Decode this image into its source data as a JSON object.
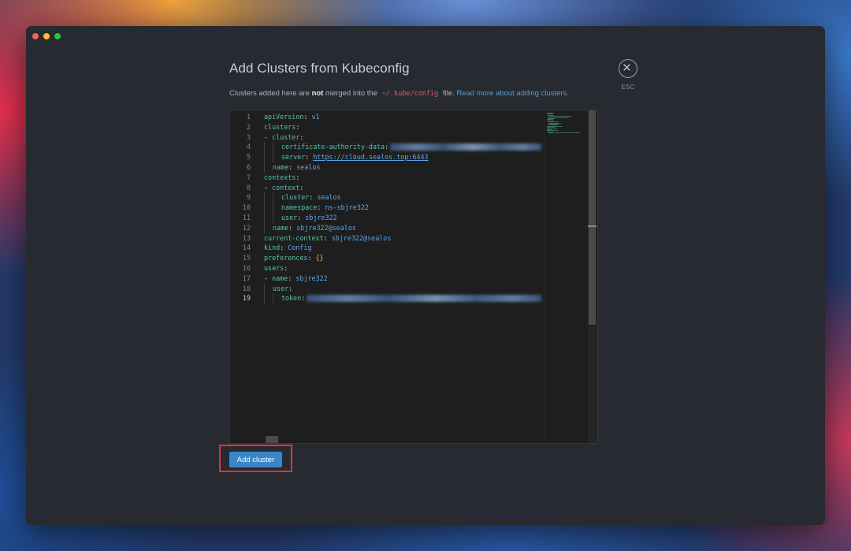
{
  "dialog": {
    "title": "Add Clusters from Kubeconfig",
    "esc_label": "ESC",
    "subtitle": {
      "prefix": "Clusters added here are",
      "emphasis": "not",
      "middle": "merged into the",
      "path": "~/.kube/config",
      "suffix": "file.",
      "link": "Read more about adding clusters."
    },
    "submit_label": "Add cluster"
  },
  "editor": {
    "active_line": 19,
    "lines": [
      {
        "n": "1",
        "key": "apiVersion",
        "value": "v1"
      },
      {
        "n": "2",
        "key": "clusters"
      },
      {
        "n": "3",
        "dash": "-",
        "key": "cluster"
      },
      {
        "n": "4",
        "key": "certificate-authority-data",
        "redacted": true
      },
      {
        "n": "5",
        "key": "server",
        "value": "https://cloud.sealos.top:6443"
      },
      {
        "n": "6",
        "key": "name",
        "value": "sealos"
      },
      {
        "n": "7",
        "key": "contexts"
      },
      {
        "n": "8",
        "dash": "-",
        "key": "context"
      },
      {
        "n": "9",
        "key": "cluster",
        "value": "sealos"
      },
      {
        "n": "10",
        "key": "namespace",
        "value": "ns-sbjre322"
      },
      {
        "n": "11",
        "key": "user",
        "value": "sbjre322"
      },
      {
        "n": "12",
        "key": "name",
        "value": "sbjre322@sealos"
      },
      {
        "n": "13",
        "key": "current-context",
        "value": "sbjre322@sealos"
      },
      {
        "n": "14",
        "key": "kind",
        "value": "Config"
      },
      {
        "n": "15",
        "key": "preferences",
        "value": "{}"
      },
      {
        "n": "16",
        "key": "users"
      },
      {
        "n": "17",
        "dash": "-",
        "key": "name",
        "value": "sbjre322"
      },
      {
        "n": "18",
        "key": "user"
      },
      {
        "n": "19",
        "key": "token",
        "redacted": true
      }
    ]
  }
}
